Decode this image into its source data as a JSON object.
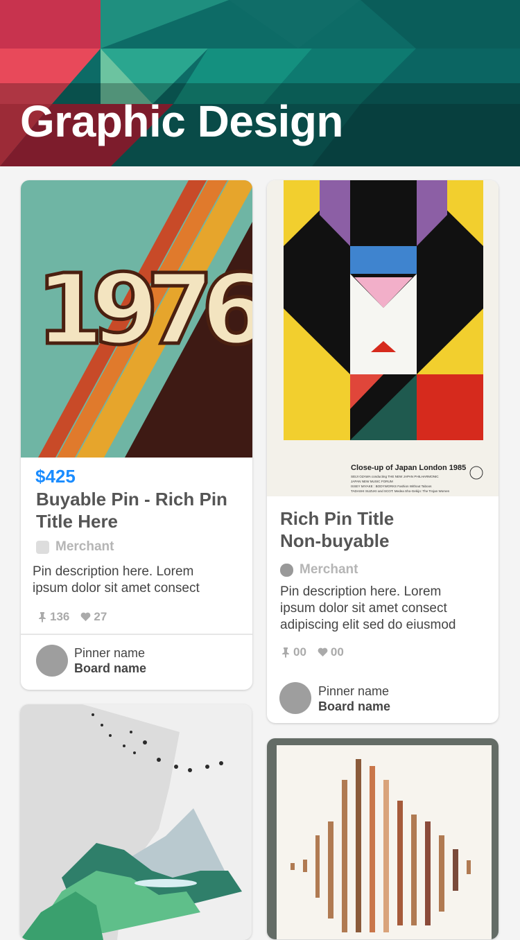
{
  "header": {
    "title": "Graphic Design"
  },
  "cards": [
    {
      "price": "$425",
      "title_line1": "Buyable Pin - Rich Pin",
      "title_line2": "Title Here",
      "merchant": "Merchant",
      "desc_line1": "Pin description here. Lorem",
      "desc_line2": "ipsum dolor sit amet consect",
      "repins": "136",
      "likes": "27",
      "pinner": "Pinner name",
      "board": "Board name",
      "image_text": "1976"
    },
    {
      "title_line1": "Rich Pin Title",
      "title_line2": "Non-buyable",
      "merchant": "Merchant",
      "desc_line1": "Pin description here. Lorem",
      "desc_line2": "ipsum dolor sit amet consect",
      "desc_line3": "adipiscing elit sed do eiusmod",
      "repins": "00",
      "likes": "00",
      "pinner": "Pinner name",
      "board": "Board name",
      "poster_title": "Close-up of Japan London 1985",
      "poster_lines": [
        "SEIJI OZAWA conducting THE NEW JAPAN PHILHARMONIC",
        "JAPAN NEW MUSIC FORUM",
        "ISSEY MIYAKE : BODYWORKS   Fashion Without Taboos",
        "TADASHI SUZUKI and SCOT: Medea Sho-Gekijo: The Trojan Women"
      ]
    }
  ],
  "icons": {
    "repin": "pushpin-icon",
    "like": "heart-icon"
  },
  "colors": {
    "price": "#1a8cff",
    "text": "#555555",
    "muted": "#b5b5b5"
  }
}
